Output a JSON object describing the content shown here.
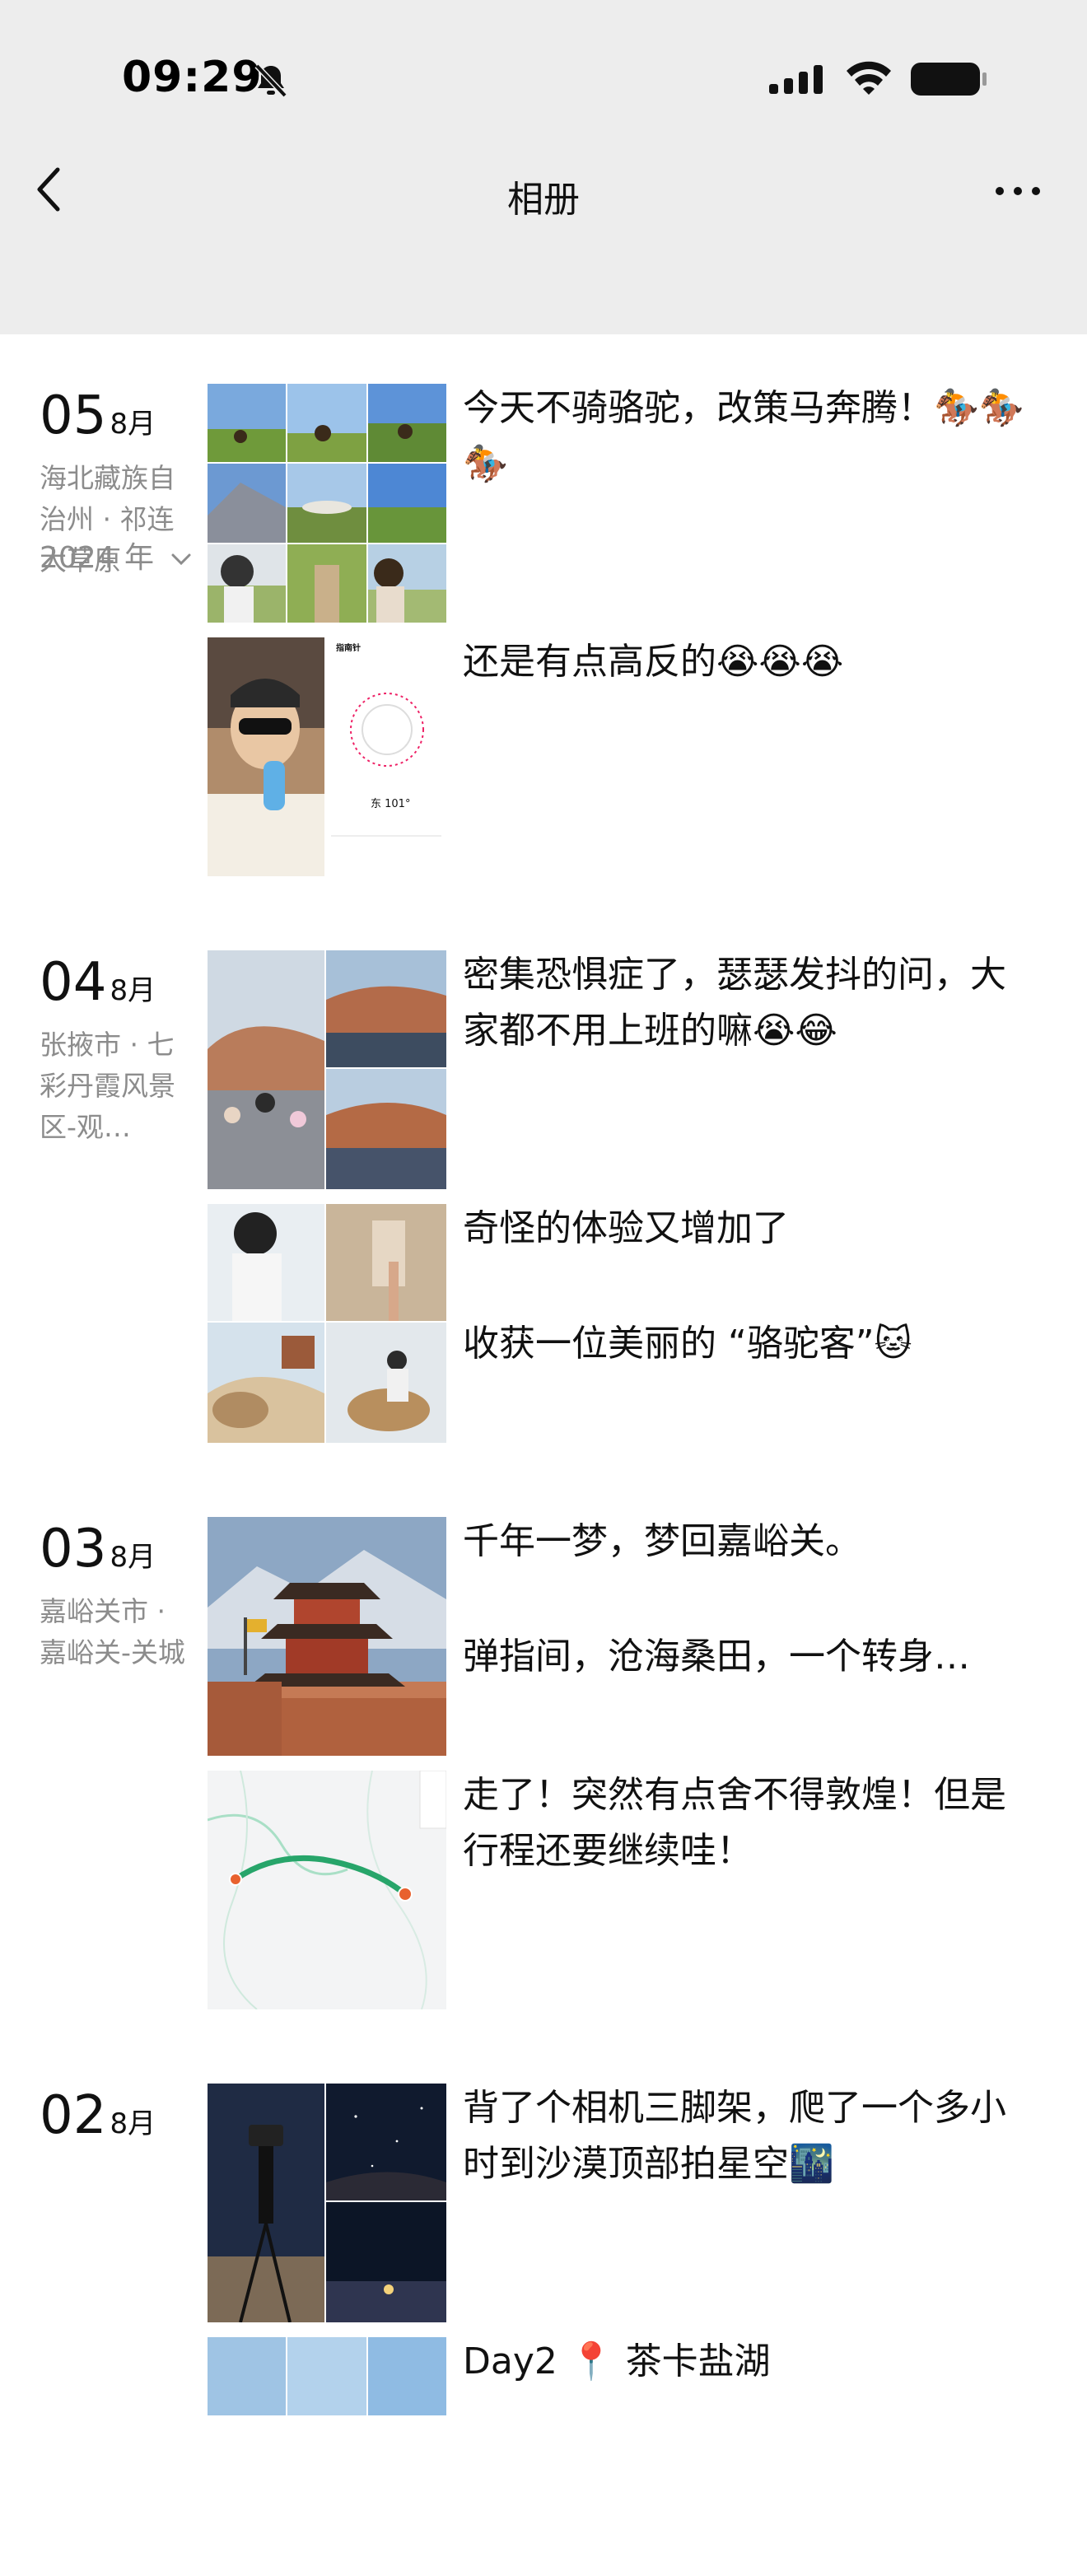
{
  "status_bar": {
    "time": "09:29"
  },
  "nav": {
    "title": "相册"
  },
  "year_filter": {
    "label": "2024 年"
  },
  "entries": [
    {
      "day": "05",
      "month": "8月",
      "location": "海北藏族自治州 · 祁连大草原",
      "posts": [
        {
          "caption": "今天不骑骆驼，改策马奔腾！🏇🏇🏇"
        },
        {
          "caption": "还是有点高反的😭😭😭",
          "inner": {
            "compass_title": "指南针",
            "compass_reading": "东 101°"
          }
        }
      ]
    },
    {
      "day": "04",
      "month": "8月",
      "location": "张掖市 · 七彩丹霞风景区-观…",
      "posts": [
        {
          "caption": "密集恐惧症了，瑟瑟发抖的问，大家都不用上班的嘛😭😂"
        },
        {
          "caption": "奇怪的体验又增加了",
          "caption2": "收获一位美丽的 “骆驼客”🐱"
        }
      ]
    },
    {
      "day": "03",
      "month": "8月",
      "location": "嘉峪关市 · 嘉峪关-关城",
      "posts": [
        {
          "caption": "千年一梦，梦回嘉峪关。",
          "caption2": "弹指间，沧海桑田，一个转身…"
        },
        {
          "caption": "走了！突然有点舍不得敦煌！但是行程还要继续哇！"
        }
      ]
    },
    {
      "day": "02",
      "month": "8月",
      "location": "",
      "posts": [
        {
          "caption": "背了个相机三脚架，爬了一个多小时到沙漠顶部拍星空🌃"
        },
        {
          "caption": "Day2 📍 茶卡盐湖"
        }
      ]
    }
  ]
}
